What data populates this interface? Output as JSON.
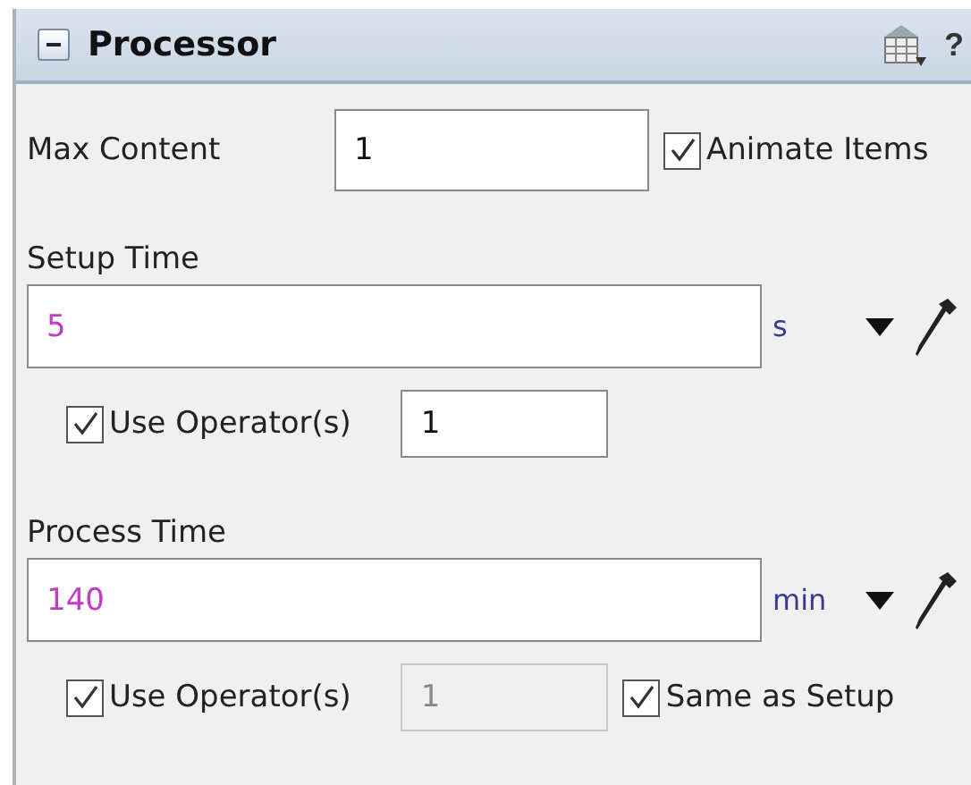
{
  "panel": {
    "title": "Processor",
    "expanded": true,
    "help": "?"
  },
  "max_content": {
    "label": "Max Content",
    "value": "1",
    "animate_items": {
      "label": "Animate Items",
      "checked": true
    }
  },
  "times": [
    {
      "label": "Setup Time",
      "value": "5",
      "unit": "s",
      "use_operators": {
        "label": "Use Operator(s)",
        "checked": true,
        "value": "1",
        "disabled": false
      }
    },
    {
      "label": "Process Time",
      "value": "140",
      "unit": "min",
      "use_operators": {
        "label": "Use Operator(s)",
        "checked": true,
        "value": "1",
        "disabled": true
      },
      "same_as_setup": {
        "label": "Same as Setup",
        "checked": true
      }
    }
  ]
}
